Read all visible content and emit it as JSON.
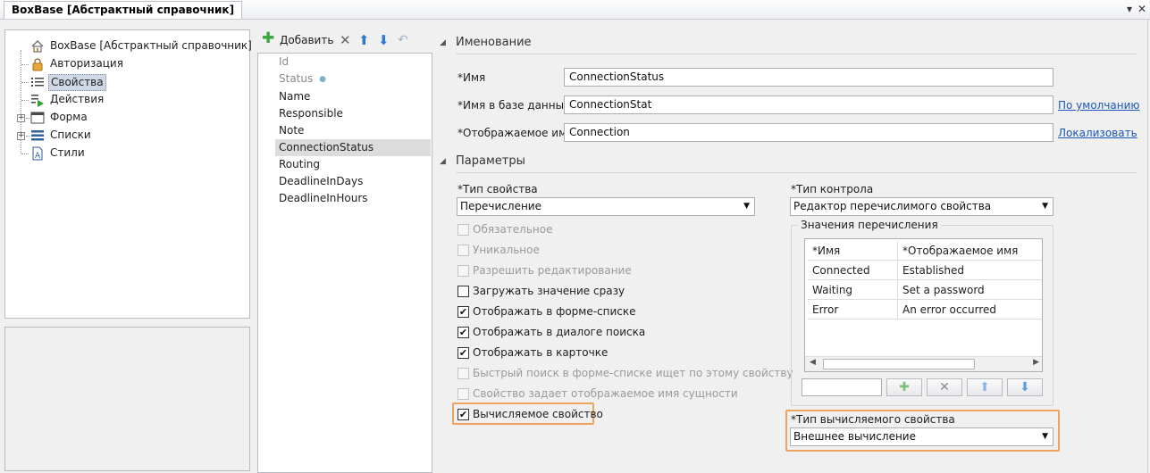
{
  "window": {
    "title": "BoxBase [Абстрактный справочник]"
  },
  "tree": {
    "items": [
      {
        "label": "BoxBase [Абстрактный справочник]",
        "icon": "home-icon"
      },
      {
        "label": "Авторизация",
        "icon": "lock-icon"
      },
      {
        "label": "Свойства",
        "icon": "list-icon",
        "selected": true
      },
      {
        "label": "Действия",
        "icon": "actions-icon"
      },
      {
        "label": "Форма",
        "icon": "form-icon",
        "expandable": true
      },
      {
        "label": "Списки",
        "icon": "lists-icon",
        "expandable": true
      },
      {
        "label": "Стили",
        "icon": "styles-icon"
      }
    ]
  },
  "toolbar": {
    "add_label": "Добавить"
  },
  "properties": {
    "items": [
      {
        "label": "Id",
        "muted": true
      },
      {
        "label": "Status",
        "muted": true
      },
      {
        "label": "Name"
      },
      {
        "label": "Responsible"
      },
      {
        "label": "Note"
      },
      {
        "label": "ConnectionStatus",
        "selected": true
      },
      {
        "label": "Routing"
      },
      {
        "label": "DeadlineInDays"
      },
      {
        "label": "DeadlineInHours"
      }
    ]
  },
  "naming": {
    "header": "Именование",
    "name_label": "*Имя",
    "name_value": "ConnectionStatus",
    "dbname_label": "*Имя в базе данных",
    "dbname_value": "ConnectionStat",
    "dbname_link": "По умолчанию",
    "display_label": "*Отображаемое имя",
    "display_value": "Connection",
    "display_link": "Локализовать"
  },
  "params": {
    "header": "Параметры",
    "prop_type_label": "*Тип свойства",
    "prop_type_value": "Перечисление",
    "control_type_label": "*Тип контрола",
    "control_type_value": "Редактор перечислимого свойства",
    "checkboxes": [
      {
        "label": "Обязательное",
        "checked": false,
        "disabled": true
      },
      {
        "label": "Уникальное",
        "checked": false,
        "disabled": true
      },
      {
        "label": "Разрешить редактирование",
        "checked": false,
        "disabled": true
      },
      {
        "label": "Загружать значение сразу",
        "checked": false,
        "disabled": false
      },
      {
        "label": "Отображать в форме-списке",
        "checked": true,
        "disabled": false
      },
      {
        "label": "Отображать в диалоге поиска",
        "checked": true,
        "disabled": false
      },
      {
        "label": "Отображать в карточке",
        "checked": true,
        "disabled": false
      },
      {
        "label": "Быстрый поиск в форме-списке ищет по этому свойству",
        "checked": false,
        "disabled": true
      },
      {
        "label": "Свойство задает отображаемое имя сущности",
        "checked": false,
        "disabled": true
      },
      {
        "label": "Вычисляемое свойство",
        "checked": true,
        "disabled": false
      }
    ],
    "enum_group_label": "Значения перечисления",
    "enum_columns": [
      "*Имя",
      "*Отображаемое имя"
    ],
    "enum_rows": [
      [
        "Connected",
        "Established"
      ],
      [
        "Waiting",
        "Set a password"
      ],
      [
        "Error",
        "An error occurred"
      ]
    ],
    "calc_type_label": "*Тип вычисляемого свойства",
    "calc_type_value": "Внешнее вычисление"
  },
  "colors": {
    "highlight": "#f0a35e",
    "selection": "#cfd8e4",
    "link": "#1a56b8",
    "add_green": "#3aa53a",
    "arrow_blue": "#2d7bd0"
  }
}
